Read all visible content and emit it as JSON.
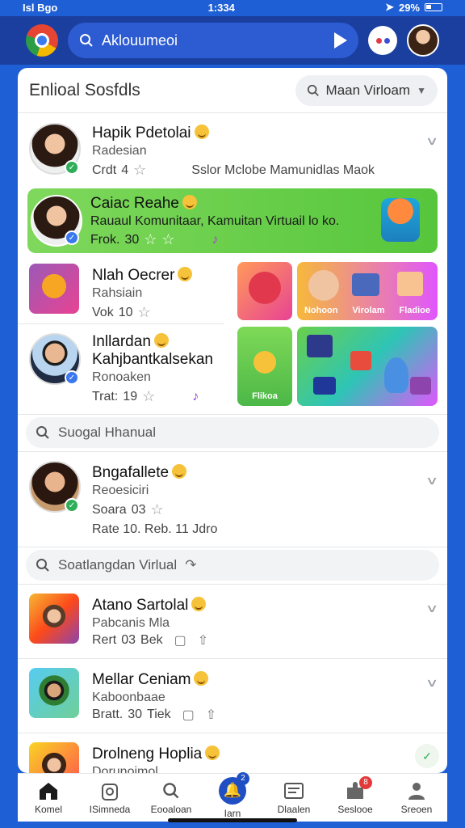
{
  "status": {
    "carrier": "Isl Bgo",
    "time": "1:334",
    "battery": "29%"
  },
  "topbar": {
    "search_text": "Aklouumeoi"
  },
  "panel": {
    "title": "Enlioal Sosfdls",
    "filter_label": "Maan Virloam"
  },
  "items": [
    {
      "name": "Hapik Pdetolai",
      "sub": "Radesian",
      "meta1": "Crdt",
      "meta2": "4",
      "meta3": "Sslor Mclobe Mamunidlas Maok"
    },
    {
      "name": "Caiac Reahe",
      "sub": "Rauaul Komunitaar, Kamuitan Virtuail lo ko.",
      "meta1": "Frok.",
      "meta2": "30"
    },
    {
      "name": "Nlah Oecrer",
      "sub": "Rahsiain",
      "meta1": "Vok",
      "meta2": "10"
    },
    {
      "name": "Inllardan",
      "name2": "Kahjbantkalsekan",
      "sub": "Ronoaken",
      "meta1": "Trat:",
      "meta2": "19"
    },
    {
      "name": "Bngafallete",
      "sub": "Reoesiciri",
      "meta1": "Soara",
      "meta2": "03",
      "meta3": "Rate 10.  Reb. 11 Jdro"
    },
    {
      "name": "Atano Sartolal",
      "sub": "Pabcanis Mla",
      "meta1": "Rert",
      "meta2": "03",
      "meta3": "Bek"
    },
    {
      "name": "Mellar Ceniam",
      "sub": "Kaboonbaae",
      "meta1": "Bratt.",
      "meta2": "30",
      "meta3": "Tiek"
    },
    {
      "name": "Drolneng Hoplia",
      "sub": "Dorunoimol"
    }
  ],
  "tiles": {
    "t1": "",
    "t2": "Nohoon",
    "t3": "Virolam",
    "t4": "Fladioe",
    "t5": "Flikoa"
  },
  "searches": {
    "s1": "Suogal Hhanual",
    "s2": "Soatlangdan Virlual"
  },
  "nav": [
    {
      "label": "Komel"
    },
    {
      "label": "ISimneda"
    },
    {
      "label": "Eooaloan"
    },
    {
      "label": "Iarn",
      "badge": "2"
    },
    {
      "label": "Dlaalen"
    },
    {
      "label": "Seslooe",
      "badge": "8"
    },
    {
      "label": "Sreoen"
    }
  ],
  "colors": {
    "accent": "#1f4fc2",
    "background": "#1f5fd6",
    "highlight": "#6ad04a"
  }
}
